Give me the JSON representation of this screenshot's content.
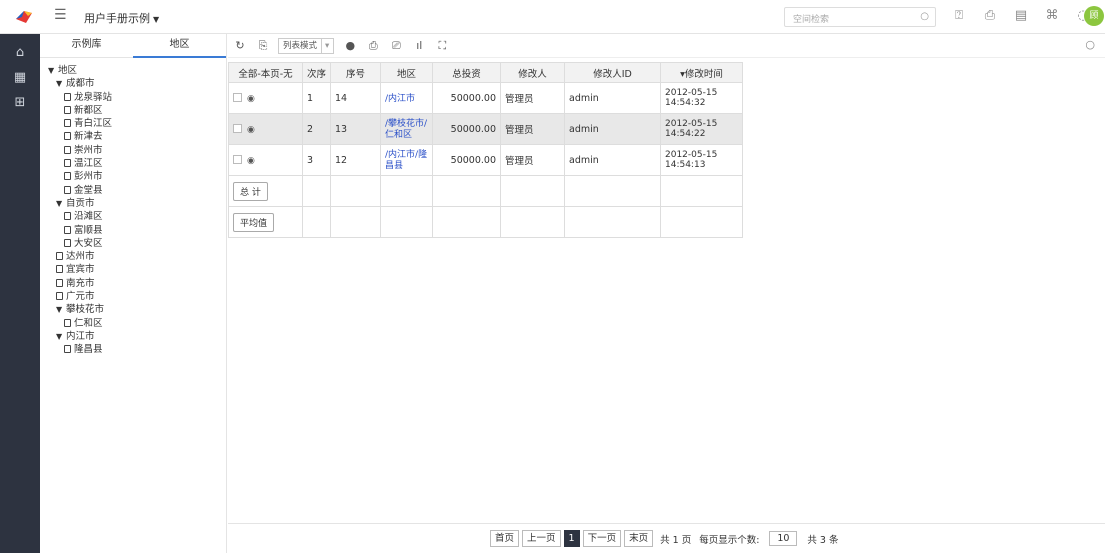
{
  "topbar": {
    "app_title": "用户手册示例",
    "search_placeholder": "空间检索",
    "avatar_text": "顾"
  },
  "tree_tabs": [
    "示例库",
    "地区"
  ],
  "tree": [
    {
      "level": 0,
      "type": "folder",
      "label": "地区"
    },
    {
      "level": 1,
      "type": "folder",
      "label": "成都市"
    },
    {
      "level": 2,
      "type": "leaf",
      "label": "龙泉驿站"
    },
    {
      "level": 2,
      "type": "leaf",
      "label": "新都区"
    },
    {
      "level": 2,
      "type": "leaf",
      "label": "青白江区"
    },
    {
      "level": 2,
      "type": "leaf",
      "label": "新津去"
    },
    {
      "level": 2,
      "type": "leaf",
      "label": "崇州市"
    },
    {
      "level": 2,
      "type": "leaf",
      "label": "温江区"
    },
    {
      "level": 2,
      "type": "leaf",
      "label": "彭州市"
    },
    {
      "level": 2,
      "type": "leaf",
      "label": "金堂县"
    },
    {
      "level": 1,
      "type": "folder",
      "label": "自贡市"
    },
    {
      "level": 2,
      "type": "leaf",
      "label": "沿滩区"
    },
    {
      "level": 2,
      "type": "leaf",
      "label": "富顺县"
    },
    {
      "level": 2,
      "type": "leaf",
      "label": "大安区"
    },
    {
      "level": 1,
      "type": "leaf",
      "label": "达州市"
    },
    {
      "level": 1,
      "type": "leaf",
      "label": "宜宾市"
    },
    {
      "level": 1,
      "type": "leaf",
      "label": "南充市"
    },
    {
      "level": 1,
      "type": "leaf",
      "label": "广元市"
    },
    {
      "level": 1,
      "type": "folder",
      "label": "攀枝花市"
    },
    {
      "level": 2,
      "type": "leaf",
      "label": "仁和区"
    },
    {
      "level": 1,
      "type": "folder",
      "label": "内江市"
    },
    {
      "level": 2,
      "type": "leaf",
      "label": "隆昌县"
    }
  ],
  "toolbar": {
    "mode_label": "列表模式"
  },
  "table": {
    "headers": [
      "全部-本页-无",
      "次序",
      "序号",
      "地区",
      "总投资",
      "修改人",
      "修改人ID",
      "▾修改时间"
    ],
    "rows": [
      {
        "order": "1",
        "seq": "14",
        "region": "/内江市",
        "invest": "50000.00",
        "modifier": "管理员",
        "modifier_id": "admin",
        "time": "2012-05-15 14:54:32",
        "selected": false
      },
      {
        "order": "2",
        "seq": "13",
        "region": "/攀枝花市/仁和区",
        "invest": "50000.00",
        "modifier": "管理员",
        "modifier_id": "admin",
        "time": "2012-05-15 14:54:22",
        "selected": true
      },
      {
        "order": "3",
        "seq": "12",
        "region": "/内江市/隆昌县",
        "invest": "50000.00",
        "modifier": "管理员",
        "modifier_id": "admin",
        "time": "2012-05-15 14:54:13",
        "selected": false
      }
    ],
    "total_label": "总 计",
    "avg_label": "平均值"
  },
  "pager": {
    "first": "首页",
    "prev": "上一页",
    "current": "1",
    "next": "下一页",
    "last": "末页",
    "total_pages": "共 1 页",
    "per_page_label": "每页显示个数:",
    "per_page": "10",
    "total_items": "共 3 条"
  }
}
